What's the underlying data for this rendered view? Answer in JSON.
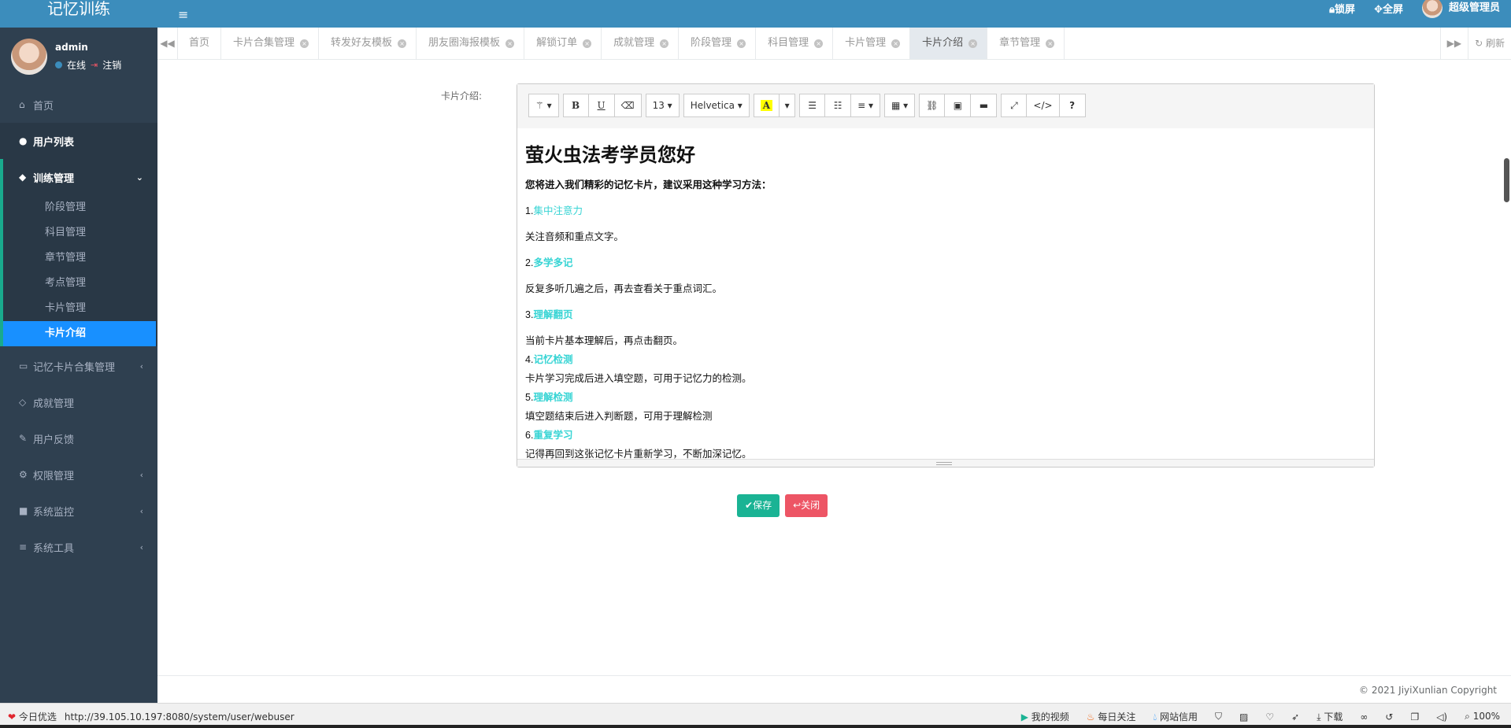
{
  "app": {
    "brand": "记忆训练"
  },
  "user": {
    "name": "admin",
    "status": "在线",
    "logout": "注销"
  },
  "sidebar": {
    "items": [
      {
        "label": "首页",
        "icon": "home-icon"
      },
      {
        "label": "用户列表",
        "icon": "user-circle-icon"
      },
      {
        "label": "训练管理",
        "icon": "cube-icon"
      },
      {
        "label": "记忆卡片合集管理",
        "icon": "card-icon"
      },
      {
        "label": "成就管理",
        "icon": "diamond-icon"
      },
      {
        "label": "用户反馈",
        "icon": "edit-icon"
      },
      {
        "label": "权限管理",
        "icon": "gear-icon"
      },
      {
        "label": "系统监控",
        "icon": "video-icon"
      },
      {
        "label": "系统工具",
        "icon": "bars-icon"
      }
    ],
    "submenu": [
      "阶段管理",
      "科目管理",
      "章节管理",
      "考点管理",
      "卡片管理",
      "卡片介绍"
    ]
  },
  "topbar": {
    "lock": "锁屏",
    "fullscreen": "全屏",
    "admin": "超级管理员"
  },
  "tabs": [
    "首页",
    "卡片合集管理",
    "转发好友模板",
    "朋友圈海报模板",
    "解锁订单",
    "成就管理",
    "阶段管理",
    "科目管理",
    "卡片管理",
    "卡片介绍",
    "章节管理"
  ],
  "tabbar": {
    "refresh": "刷新"
  },
  "form": {
    "label": "卡片介绍:"
  },
  "toolbar": {
    "font_size": "13",
    "font_name": "Helvetica",
    "highlight": "A",
    "help": "?"
  },
  "editor": {
    "heading": "萤火虫法考学员您好",
    "intro": "您将进入我们精彩的记忆卡片，建议采用这种学习方法：",
    "s1_num": "1.",
    "s1_title": "集中注意力",
    "s1_text": "关注音频和重点文字。",
    "s2_num": "2.",
    "s2_title": "多学多记",
    "s2_text": "反复多听几遍之后，再去查看关于重点词汇。",
    "s3_num": "3.",
    "s3_title": "理解翻页",
    "s3_text": "当前卡片基本理解后，再点击翻页。",
    "s4_num": "4.",
    "s4_title": "记忆检测",
    "s4_text": "卡片学习完成后进入填空题，可用于记忆力的检测。",
    "s5_num": "5.",
    "s5_title": "理解检测",
    "s5_text": "填空题结束后进入判断题，可用于理解检测",
    "s6_num": "6.",
    "s6_title": "重复学习",
    "s6_text": "记得再回到这张记忆卡片重新学习，不断加深记忆。"
  },
  "actions": {
    "save": "保存",
    "close": "关闭"
  },
  "footer": {
    "copyright": "© 2021 JiyiXunlian Copyright"
  },
  "browser_status": {
    "today": "今日优选",
    "url": "http://39.105.10.197:8080/system/user/webuser",
    "video": "我的视频",
    "daily": "每日关注",
    "credit": "网站信用",
    "download": "下载",
    "zoom": "100%"
  },
  "colors": {
    "sidebar": "#2f4050",
    "topbar": "#3c8dbc",
    "active_sub": "#1890ff",
    "save": "#1ab394",
    "close": "#ed5565",
    "highlight_text": "#37d4d4"
  }
}
